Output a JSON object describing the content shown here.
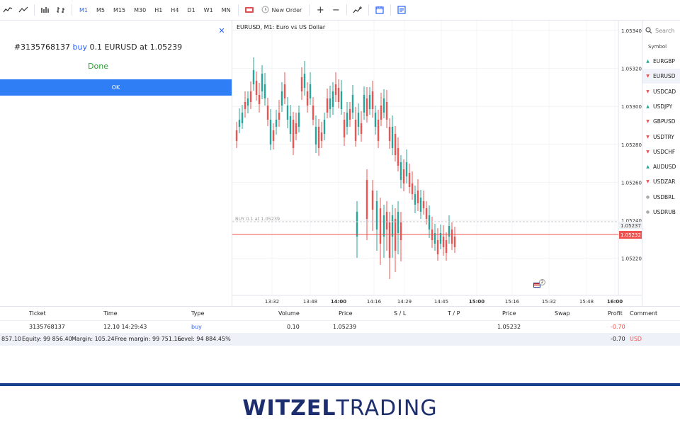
{
  "toolbar": {
    "timeframes": [
      "M1",
      "M5",
      "M15",
      "M30",
      "H1",
      "H4",
      "D1",
      "W1",
      "MN"
    ],
    "active_timeframe": "M1",
    "new_order_label": "New Order",
    "icons": [
      "bar-chart-icon",
      "line-chart-icon",
      "candles-icon",
      "bars-icon",
      "flag-icon",
      "clock-icon",
      "zoom-in-icon",
      "zoom-out-icon",
      "indicators-icon",
      "calendar-icon",
      "news-icon"
    ]
  },
  "order_result": {
    "ticket": "#3135768137",
    "side": "buy",
    "rest": "0.1 EURUSD at 1.05239",
    "status": "Done",
    "ok_label": "OK"
  },
  "chart": {
    "title": "EURUSD, M1: Euro vs US Dollar",
    "price_levels": [
      "1.05340",
      "1.05320",
      "1.05300",
      "1.05280",
      "1.05260",
      "1.05240",
      "1.05220"
    ],
    "time_labels": [
      "13:32",
      "13:48",
      "14:00",
      "14:16",
      "14:29",
      "14:45",
      "15:00",
      "15:16",
      "15:32",
      "15:48",
      "16:00"
    ],
    "order_line_label": "BUY 0.1 at 1.05239",
    "price_tag_gray": "1.05237",
    "price_tag_red": "1.05232",
    "flag_badge": "2"
  },
  "watchlist": {
    "search_placeholder": "Search",
    "header": "Symbol",
    "items": [
      {
        "symbol": "EURGBP",
        "dir": "up"
      },
      {
        "symbol": "EURUSD",
        "dir": "down"
      },
      {
        "symbol": "USDCAD",
        "dir": "down"
      },
      {
        "symbol": "USDJPY",
        "dir": "up"
      },
      {
        "symbol": "GBPUSD",
        "dir": "down"
      },
      {
        "symbol": "USDTRY",
        "dir": "down"
      },
      {
        "symbol": "USDCHF",
        "dir": "down"
      },
      {
        "symbol": "AUDUSD",
        "dir": "up"
      },
      {
        "symbol": "USDZAR",
        "dir": "down"
      },
      {
        "symbol": "USDBRL",
        "dir": "flat"
      },
      {
        "symbol": "USDRUB",
        "dir": "flat"
      }
    ]
  },
  "positions": {
    "headers": {
      "ticket": "Ticket",
      "time": "Time",
      "type": "Type",
      "volume": "Volume",
      "price": "Price",
      "sl": "S / L",
      "tp": "T / P",
      "price2": "Price",
      "swap": "Swap",
      "profit": "Profit",
      "comment": "Comment"
    },
    "row": {
      "ticket": "3135768137",
      "time": "12.10 14:29:43",
      "type": "buy",
      "volume": "0.10",
      "price": "1.05239",
      "price2": "1.05232",
      "profit": "-0.70"
    },
    "account": {
      "balance": "857.10",
      "equity": "Equity: 99 856.40",
      "margin": "Margin: 105.24",
      "free_margin": "Free margin: 99 751.16",
      "level": "Level: 94 884.45%",
      "profit": "-0.70",
      "currency": "USD"
    }
  },
  "brand": {
    "part1": "WITZEL",
    "part2": "TRADING"
  },
  "colors": {
    "up": "#26a69a",
    "down": "#ef5350",
    "accent": "#2962ff",
    "done": "#26a22e",
    "ok_button": "#2f7ef6",
    "brand": "#1d2e6e"
  }
}
